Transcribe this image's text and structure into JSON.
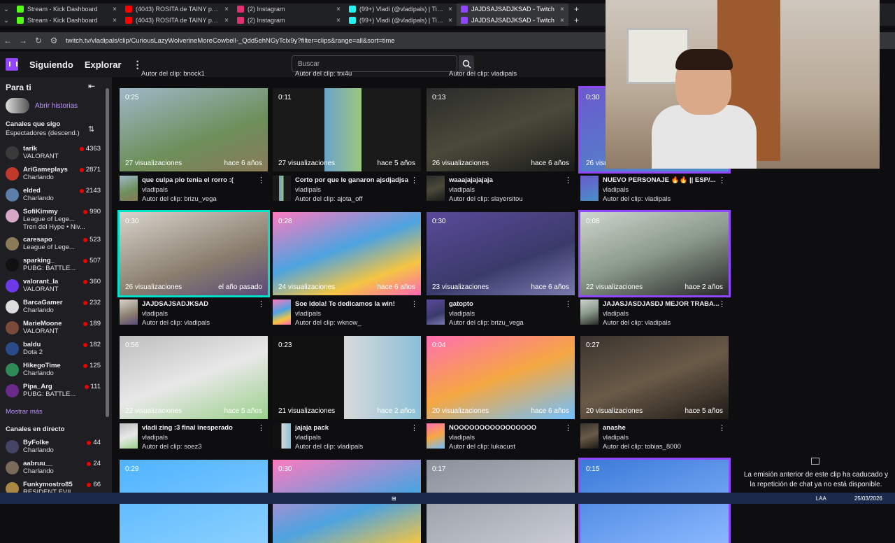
{
  "browser": {
    "tabs_row1": [
      {
        "label": "Stream - Kick Dashboard",
        "color": "#53fc18",
        "active": false
      },
      {
        "label": "(4043) ROSITA de TAINY pero c",
        "color": "#ff0000",
        "active": false
      },
      {
        "label": "(2) Instagram",
        "color": "#e1306c",
        "active": false
      },
      {
        "label": "(99+) Vladi (@vladipals) | TikTok",
        "color": "#25f4ee",
        "active": false
      },
      {
        "label": "JAJDSAJSADJKSAD - Twitch",
        "color": "#9147ff",
        "active": true
      }
    ],
    "tabs_row2": [
      {
        "label": "Stream - Kick Dashboard",
        "color": "#53fc18",
        "active": false
      },
      {
        "label": "(4043) ROSITA de TAINY pero c",
        "color": "#ff0000",
        "active": false
      },
      {
        "label": "(2) Instagram",
        "color": "#e1306c",
        "active": false
      },
      {
        "label": "(99+) Vladi (@vladipals) | TikTok",
        "color": "#25f4ee",
        "active": false
      },
      {
        "label": "JAJDSAJSADJKSAD - Twitch",
        "color": "#9147ff",
        "active": true
      }
    ],
    "url": "twitch.tv/vladipals/clip/CuriousLazyWolverineMoreCowbell-_Qdd5ehNGyTclx9y?filter=clips&range=all&sort=time"
  },
  "header": {
    "following": "Siguiendo",
    "browse": "Explorar",
    "search_placeholder": "Buscar"
  },
  "sidebar": {
    "title": "Para ti",
    "stories": "Abrir historias",
    "followed_title": "Canales que sigo",
    "followed_sort": "Espectadores (descend.)",
    "channels": [
      {
        "name": "tarik",
        "category": "VALORANT",
        "viewers": "4363",
        "color": "#3a3a3a"
      },
      {
        "name": "AriGameplays",
        "category": "Charlando",
        "viewers": "2871",
        "color": "#c0392b"
      },
      {
        "name": "elded",
        "category": "Charlando",
        "viewers": "2143",
        "color": "#5d7ea8"
      },
      {
        "name": "SofiKimmy",
        "category": "League of Lege...",
        "extra": "Tren del Hype • Niv...",
        "viewers": "990",
        "color": "#d7a7c8"
      },
      {
        "name": "caresapo",
        "category": "League of Lege...",
        "viewers": "523",
        "color": "#8a7a5a"
      },
      {
        "name": "sparking_",
        "category": "PUBG: BATTLE...",
        "viewers": "507",
        "color": "#111111"
      },
      {
        "name": "valorant_la",
        "category": "VALORANT",
        "viewers": "360",
        "color": "#6c3ae8"
      },
      {
        "name": "BarcaGamer",
        "category": "Charlando",
        "viewers": "232",
        "color": "#dddddd"
      },
      {
        "name": "MarieMoone",
        "category": "VALORANT",
        "viewers": "189",
        "color": "#7a4a3a"
      },
      {
        "name": "baldu",
        "category": "Dota 2",
        "viewers": "182",
        "color": "#2a4a8a"
      },
      {
        "name": "HikegoTime",
        "category": "Charlando",
        "viewers": "125",
        "color": "#2e8b57"
      },
      {
        "name": "Pipa_Arg",
        "category": "PUBG: BATTLE...",
        "viewers": "111",
        "color": "#6b2a8a"
      }
    ],
    "show_more": "Mostrar más",
    "live_title": "Canales en directo",
    "live": [
      {
        "name": "ByFolke",
        "category": "Charlando",
        "viewers": "44",
        "color": "#444466"
      },
      {
        "name": "aabruu__",
        "category": "Charlando",
        "viewers": "24",
        "color": "#7a6a5a"
      },
      {
        "name": "Funkymostro85",
        "category": "RESIDENT EVIL",
        "viewers": "66",
        "color": "#aa8844"
      }
    ]
  },
  "top_partial": [
    {
      "author": "Autor del clip: bnock1"
    },
    {
      "author": "Autor del clip: trx4u"
    },
    {
      "author": "Autor del clip: vladipals"
    }
  ],
  "clips": [
    {
      "duration": "0:25",
      "views": "27 visualizaciones",
      "age": "hace 6 años",
      "title": "que culpa pio tenia el rorro :(",
      "channel": "vladipals",
      "author": "Autor del clip: brizu_vega",
      "bg": "linear-gradient(160deg,#9fb7c9,#6d8f5a 60%,#8a7a5a)"
    },
    {
      "duration": "0:11",
      "views": "27 visualizaciones",
      "age": "hace 5 años",
      "title": "Corto por que le ganaron ajsdjadjsa",
      "channel": "vladipals",
      "author": "Autor del clip: ajota_off",
      "bg": "linear-gradient(90deg,#1a1a1a 35%,#6aa3c9 35%,#9dc77e 60%,#1a1a1a 60%)"
    },
    {
      "duration": "0:13",
      "views": "26 visualizaciones",
      "age": "hace 6 años",
      "title": "waaajajajajaja",
      "channel": "vladipals",
      "author": "Autor del clip: slayersitou",
      "bg": "linear-gradient(160deg,#2b2b2b,#4a4a3a 50%,#1a1a1a)"
    },
    {
      "duration": "0:30",
      "views": "26 visualizaciones",
      "age": "",
      "title": "NUEVO PERSONAJE 🔥🔥 || ESP/...",
      "channel": "vladipals",
      "author": "Autor del clip: vladipals",
      "bg": "linear-gradient(160deg,#6a5acd,#4a90c9)"
    },
    {
      "duration": "0:30",
      "views": "26 visualizaciones",
      "age": "el año pasado",
      "title": "JAJDSAJSADJKSAD",
      "channel": "vladipals",
      "author": "Autor del clip: vladipals",
      "bg": "linear-gradient(160deg,#d8d4cc,#8a7e6e 60%,#5a4a7a)"
    },
    {
      "duration": "0:28",
      "views": "24 visualizaciones",
      "age": "hace 6 años",
      "title": "Soe Idola! Te dedicamos la win!",
      "channel": "vladipals",
      "author": "Autor del clip: wknow_",
      "bg": "linear-gradient(160deg,#ff7ac0,#4da3e0 45%,#f5c542 75%,#ff66b3)"
    },
    {
      "duration": "0:30",
      "views": "23 visualizaciones",
      "age": "hace 6 años",
      "title": "gatopto",
      "channel": "vladipals",
      "author": "Autor del clip: brizu_vega",
      "bg": "linear-gradient(160deg,#5a4a9a,#3a3a6a 60%,#7a7ab0)"
    },
    {
      "duration": "0:08",
      "views": "22 visualizaciones",
      "age": "hace 2 años",
      "title": "JAJASJASDJASDJ MEJOR TRABA...",
      "channel": "vladipals",
      "author": "Autor del clip: vladipals",
      "bg": "linear-gradient(160deg,#cfd5cf,#8a9a8a 50%,#2a2a2a)"
    },
    {
      "duration": "0:56",
      "views": "22 visualizaciones",
      "age": "hace 5 años",
      "title": "vladi zing :3 final inesperado",
      "channel": "vladipals",
      "author": "Autor del clip: soez3",
      "bg": "linear-gradient(160deg,#bdbdbd,#e8e8e8 50%,#9ad08a)"
    },
    {
      "duration": "0:23",
      "views": "21 visualizaciones",
      "age": "hace 2 años",
      "title": "jajaja pack",
      "channel": "vladipals",
      "author": "Autor del clip: vladipals",
      "bg": "linear-gradient(90deg,#111 48%,#d9d9d9 48%,#8ac0d8)"
    },
    {
      "duration": "0:04",
      "views": "20 visualizaciones",
      "age": "hace 6 años",
      "title": "NOOOOOOOOOOOOOOOO",
      "channel": "vladipals",
      "author": "Autor del clip: lukacust",
      "bg": "linear-gradient(160deg,#ff6fb0,#f5a742 50%,#6fc0ff)"
    },
    {
      "duration": "0:27",
      "views": "20 visualizaciones",
      "age": "hace 5 años",
      "title": "anashe",
      "channel": "vladipals",
      "author": "Autor del clip: tobias_8000",
      "bg": "linear-gradient(160deg,#3a342e,#6a5a48 50%,#1e1a16)"
    },
    {
      "duration": "0:29",
      "bg": "linear-gradient(160deg,#4fb3ff,#8ad0ff)"
    },
    {
      "duration": "0:30",
      "bg": "linear-gradient(160deg,#ff7ac0,#4da3e0 60%,#f5c542)"
    },
    {
      "duration": "0:17",
      "bg": "linear-gradient(160deg,#8a8f9a,#c9ccd3)"
    },
    {
      "duration": "0:15",
      "bg": "linear-gradient(160deg,#3a7ad8,#8ab8ff)"
    }
  ],
  "notice": "La emisión anterior de este clip ha caducado y la repetición de chat ya no está disponible.",
  "taskbar": {
    "lang": "LAA",
    "date": "25/03/2026"
  }
}
